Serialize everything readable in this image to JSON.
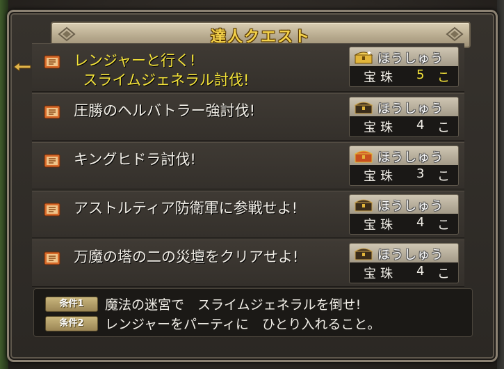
{
  "window": {
    "title": "達人クエスト"
  },
  "quests": [
    {
      "name_line1": "レンジャーと行く!",
      "name_line2": "スライムジェネラル討伐!",
      "reward_label": "ほうしゅう",
      "reward_item": "宝珠",
      "reward_qty": "5",
      "reward_unit": "こ",
      "chest": "gold-chest-icon",
      "selected": true
    },
    {
      "name_line1": "圧勝のヘルバトラー強討伐!",
      "name_line2": "",
      "reward_label": "ほうしゅう",
      "reward_item": "宝珠",
      "reward_qty": "4",
      "reward_unit": "こ",
      "chest": "dark-chest-icon",
      "selected": false
    },
    {
      "name_line1": "キングヒドラ討伐!",
      "name_line2": "",
      "reward_label": "ほうしゅう",
      "reward_item": "宝珠",
      "reward_qty": "3",
      "reward_unit": "こ",
      "chest": "red-chest-icon",
      "selected": false
    },
    {
      "name_line1": "アストルティア防衛軍に参戦せよ!",
      "name_line2": "",
      "reward_label": "ほうしゅう",
      "reward_item": "宝珠",
      "reward_qty": "4",
      "reward_unit": "こ",
      "chest": "dark-chest-icon",
      "selected": false
    },
    {
      "name_line1": "万魔の塔の二の災壇をクリアせよ!",
      "name_line2": "",
      "reward_label": "ほうしゅう",
      "reward_item": "宝珠",
      "reward_qty": "4",
      "reward_unit": "こ",
      "chest": "dark-chest-icon",
      "selected": false
    }
  ],
  "conditions": [
    {
      "badge": "条件1",
      "text": "魔法の迷宮で　スライムジェネラルを倒せ!"
    },
    {
      "badge": "条件2",
      "text": "レンジャーをパーティに　ひとり入れること。"
    }
  ],
  "colors": {
    "selected_text": "#f4e33a",
    "normal_text": "#f2efe8",
    "title_gold": "#f4d24a"
  }
}
